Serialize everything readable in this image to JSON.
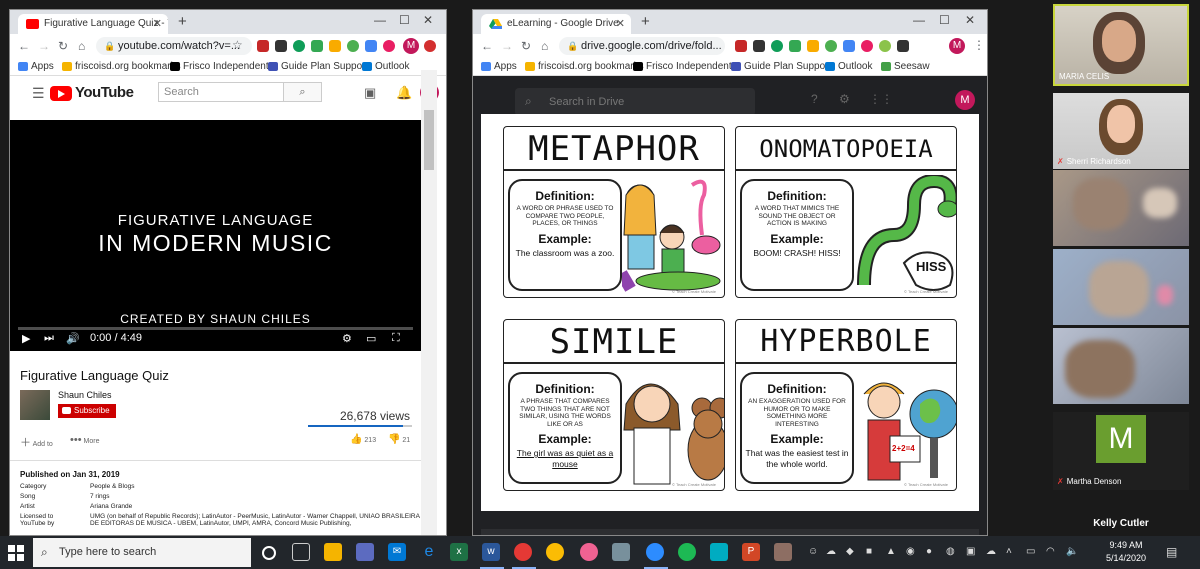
{
  "youtube_window": {
    "tab_title": "Figurative Language Quiz - YouT",
    "url": "youtube.com/watch?v=...",
    "bookmarks": [
      "Apps",
      "friscoisd.org bookmarks",
      "Frisco Independent...",
      "Guide Plan Support",
      "Outlook"
    ],
    "header": {
      "logo": "YouTube",
      "search_placeholder": "Search",
      "user_initial": "M"
    },
    "video": {
      "subtitle": "FIGURATIVE LANGUAGE",
      "title": "IN MODERN MUSIC",
      "credit": "CREATED BY SHAUN CHILES",
      "time": "0:00 / 4:49",
      "progress": 0.0
    },
    "title": "Figurative Language Quiz",
    "channel": "Shaun Chiles",
    "subscribe": "Subscribe",
    "views": "26,678 views",
    "like_ratio": 0.91,
    "actions": {
      "add": "Add to",
      "more": "More",
      "likes": "213",
      "dislikes": "21"
    },
    "published": "Published on Jan 31, 2019",
    "meta": [
      {
        "k": "Category",
        "v": "People & Blogs"
      },
      {
        "k": "Song",
        "v": "7 rings"
      },
      {
        "k": "Artist",
        "v": "Ariana Grande"
      },
      {
        "k": "Licensed to YouTube by",
        "v": "UMG (on behalf of Republic Records); LatinAutor - PeerMusic, LatinAutor - Warner Chappell, UNIAO BRASILEIRA DE EDITORAS DE MUSICA - UBEM, LatinAutor, UMPI, AMRA, Concord Music Publishing,"
      }
    ]
  },
  "drive_window": {
    "tab_title": "eLearning - Google Drive",
    "url": "drive.google.com/drive/fold...",
    "bookmarks": [
      "Apps",
      "friscoisd.org bookmarks",
      "Frisco Independent...",
      "Guide Plan Support",
      "Outlook",
      "Seesaw"
    ],
    "search_placeholder": "Search in Drive",
    "user_initial": "M",
    "cards": [
      {
        "title": "METAPHOR",
        "def_h": "Definition:",
        "def": "A WORD OR PHRASE USED TO COMPARE TWO PEOPLE, PLACES, OR THINGS",
        "ex_h": "Example:",
        "ex": "The classroom was a zoo.",
        "copy": "© Teach Create Motivate"
      },
      {
        "title": "ONOMATOPOEIA",
        "def_h": "Definition:",
        "def": "A WORD THAT MIMICS THE SOUND THE OBJECT OR ACTION IS MAKING",
        "ex_h": "Example:",
        "ex": "BOOM! CRASH! HISS!",
        "copy": "© Teach Create Motivate",
        "art_text": "HISS"
      },
      {
        "title": "SIMILE",
        "def_h": "Definition:",
        "def": "A PHRASE THAT COMPARES TWO THINGS THAT ARE NOT SIMILAR, USING THE WORDS LIKE OR AS",
        "ex_h": "Example:",
        "ex": "The girl was as quiet as a mouse",
        "copy": "© Teach Create Motivate"
      },
      {
        "title": "HYPERBOLE",
        "def_h": "Definition:",
        "def": "AN EXAGGERATION USED FOR HUMOR OR TO MAKE SOMETHING MORE INTERESTING",
        "ex_h": "Example:",
        "ex": "That was the easiest test in the whole world.",
        "copy": "© Teach Create Motivate",
        "art_text": "2+2=4"
      }
    ]
  },
  "participants": [
    {
      "name": "MARIA CELIS",
      "muted": false,
      "active": true
    },
    {
      "name": "Sherri Richardson",
      "muted": true
    },
    {
      "name": "",
      "muted": false
    },
    {
      "name": "",
      "muted": false
    },
    {
      "name": "",
      "muted": false
    },
    {
      "name": "Martha Denson",
      "muted": true,
      "initial": "M"
    },
    {
      "name": "Kelly Cutler",
      "muted": true
    }
  ],
  "taskbar": {
    "search_placeholder": "Type here to search",
    "time": "9:49 AM",
    "date": "5/14/2020"
  },
  "colors": {
    "yt_red": "#ff0000",
    "zoom_active": "#c8d63b",
    "avatar_pink": "#c2185b",
    "martha_green": "#6a9e2f"
  }
}
